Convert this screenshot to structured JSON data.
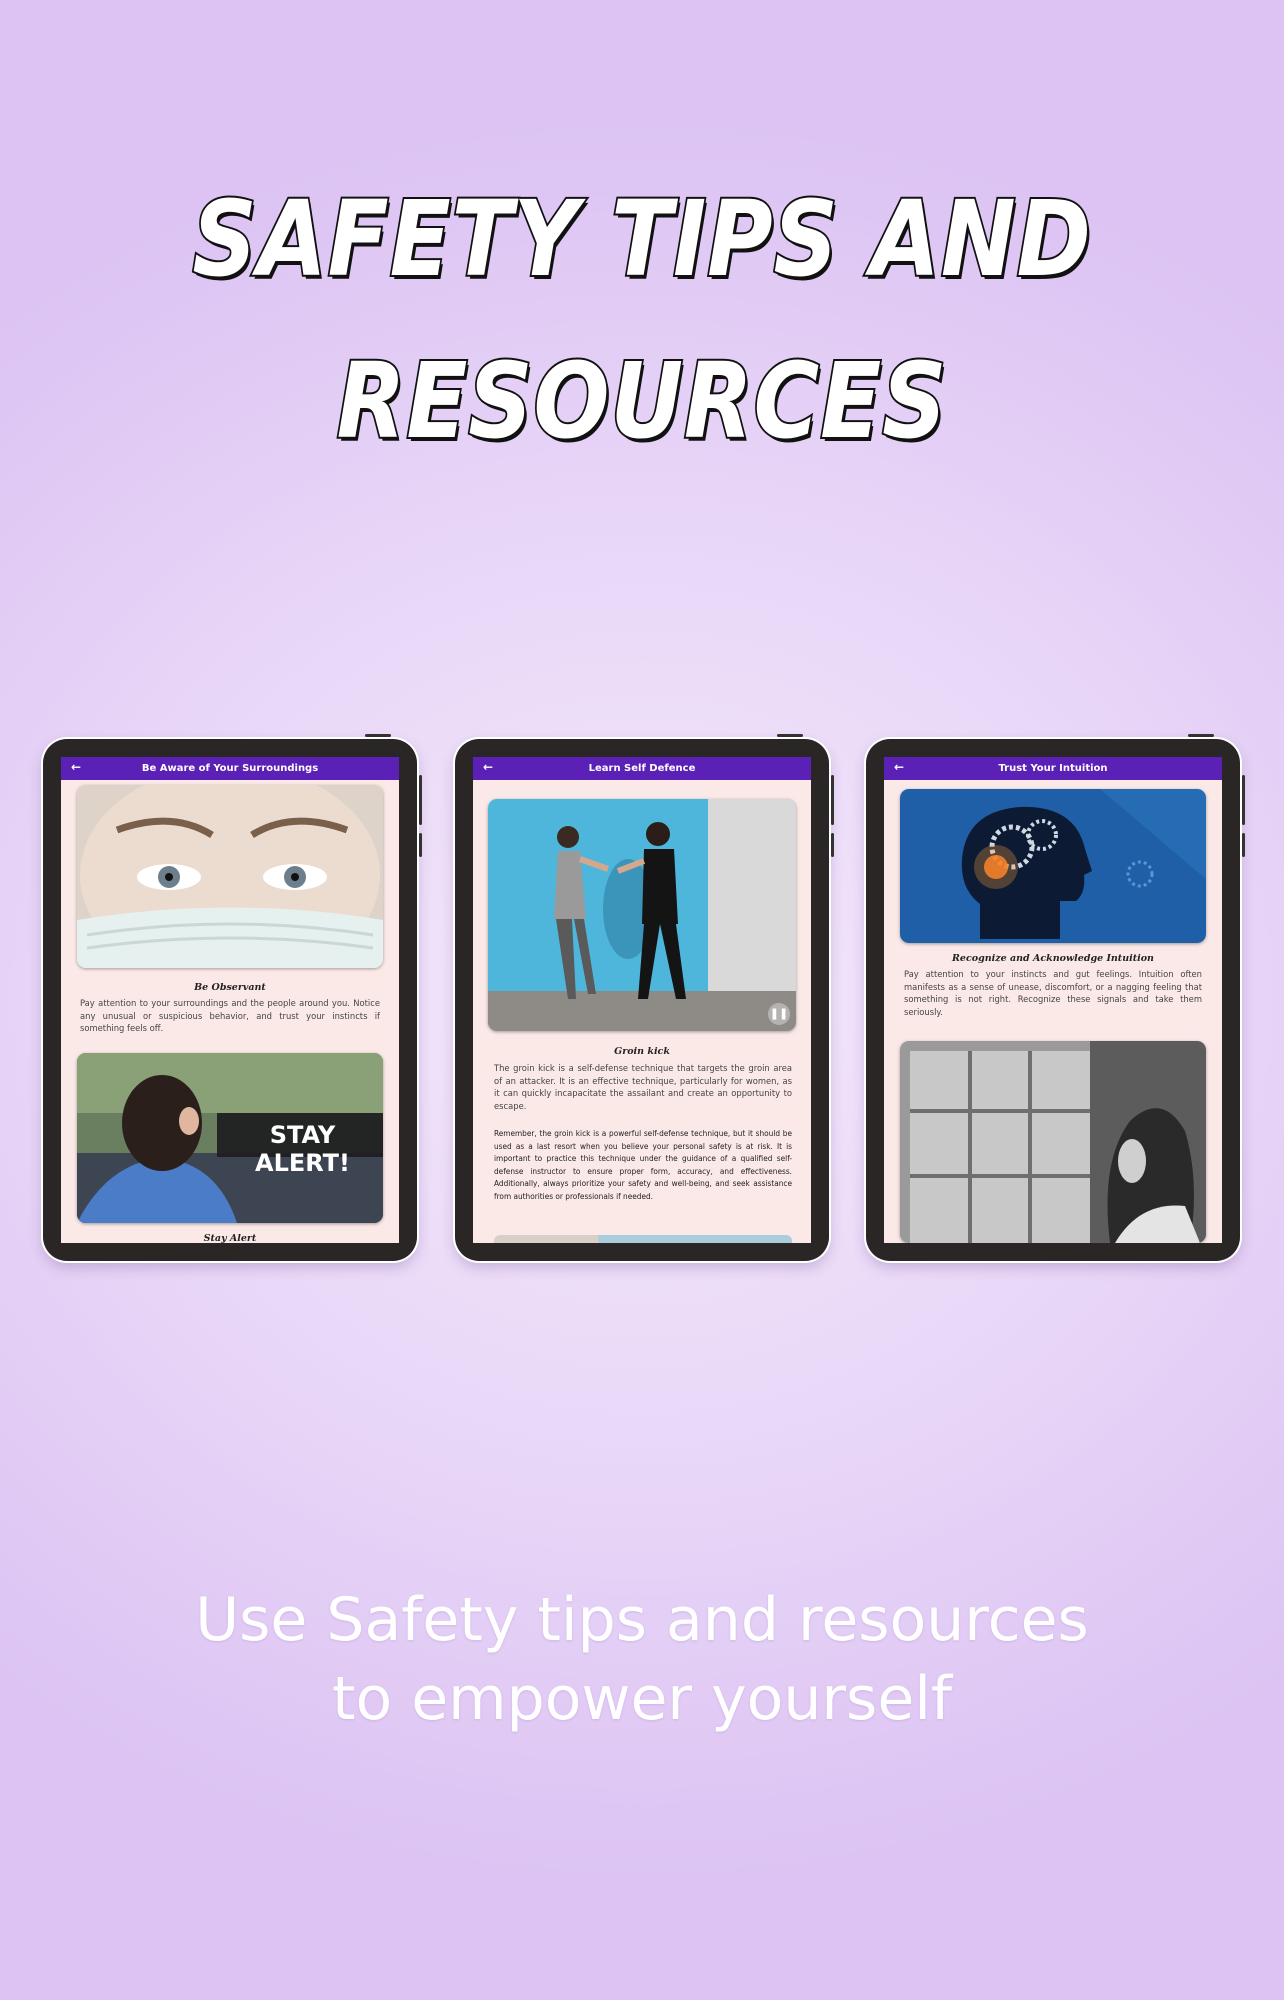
{
  "headline": {
    "line1": "SAFETY TIPS AND",
    "line2": "RESOURCES"
  },
  "tagline": {
    "line1": "Use Safety tips and resources",
    "line2": "to empower yourself"
  },
  "colors": {
    "appbar": "#5b21b6",
    "screen_bg": "#fbe9e8",
    "tablet_frame": "#2b2626"
  },
  "screens": [
    {
      "title": "Be Aware of Your Surroundings",
      "back_icon": "arrow-left-icon",
      "section1_title": "Be Observant",
      "section1_text": "Pay attention to your surroundings and the people around you. Notice any unusual or suspicious behavior, and trust your instincts if something feels off.",
      "banner_text": "STAY ALERT!",
      "section2_title": "Stay Alert"
    },
    {
      "title": "Learn Self Defence",
      "back_icon": "arrow-left-icon",
      "section1_title": "Groin kick",
      "section1_text": "The groin kick is a self-defense technique that targets the groin area of an attacker. It is an effective technique, particularly for women, as it can quickly incapacitate the assailant and create an opportunity to escape.",
      "section2_text": "Remember, the groin kick is a powerful self-defense technique, but it should be used as a last resort when you believe your personal safety is at risk. It is important to practice this technique under the guidance of a qualified self-defense instructor to ensure proper form, accuracy, and effectiveness. Additionally, always prioritize your safety and well-being, and seek assistance from authorities or professionals if needed.",
      "pause_icon": "pause-icon"
    },
    {
      "title": "Trust Your Intuition",
      "back_icon": "arrow-left-icon",
      "section1_title": "Recognize and Acknowledge Intuition",
      "section1_text": "Pay attention to your instincts and gut feelings. Intuition often manifests as a sense of unease, discomfort, or a nagging feeling that something is not right. Recognize these signals and take them seriously."
    }
  ]
}
